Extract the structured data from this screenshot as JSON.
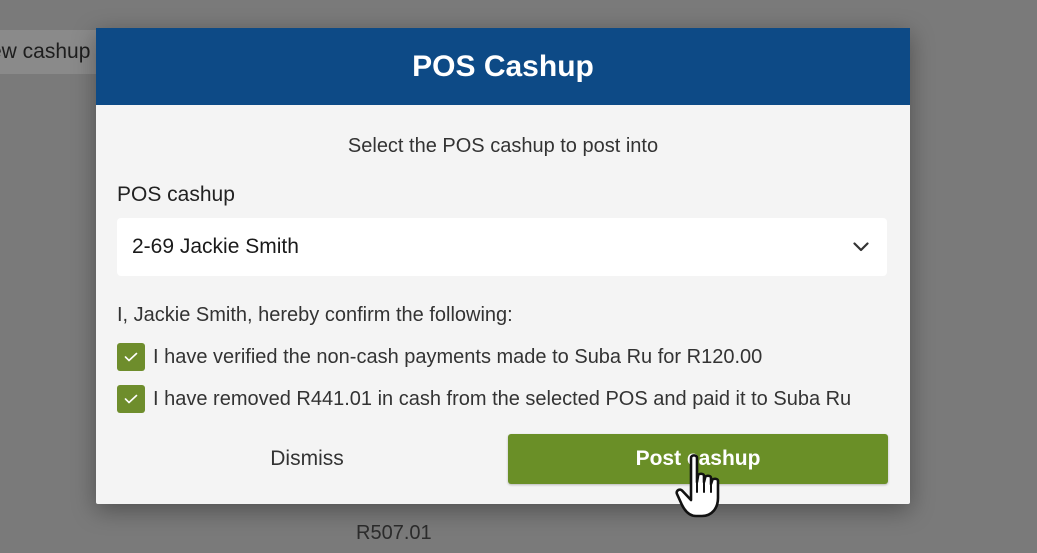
{
  "background": {
    "tab_label": "ew cashup",
    "total_amount": "R507.01"
  },
  "modal": {
    "title": "POS Cashup",
    "subtitle": "Select the POS cashup to post into",
    "field_label": "POS cashup",
    "selected_cashup": "2-69 Jackie Smith",
    "confirm_intro": "I, Jackie Smith, hereby confirm the following:",
    "confirmations": [
      {
        "text": "I have verified the non-cash payments made to Suba Ru for R120.00",
        "checked": true
      },
      {
        "text": "I have removed R441.01 in cash from the selected POS and paid it to Suba Ru",
        "checked": true
      }
    ],
    "dismiss_label": "Dismiss",
    "post_label": "Post cashup"
  },
  "colors": {
    "header": "#0d4a86",
    "accent_green": "#6a8f27",
    "overlay": "#7a7a7a"
  },
  "icons": {
    "select_arrow": "chevron-down-icon",
    "check": "checkmark-icon",
    "pointer": "hand-pointer-icon"
  }
}
